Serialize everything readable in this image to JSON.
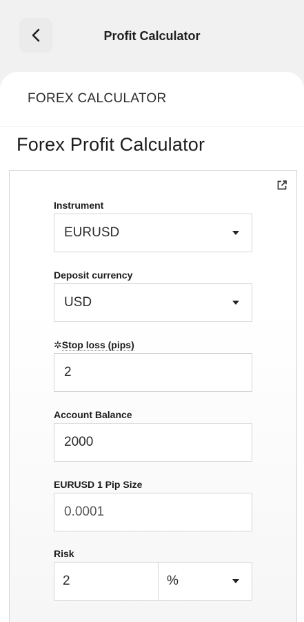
{
  "header": {
    "title": "Profit Calculator",
    "back_icon": "chevron-left-icon"
  },
  "section": {
    "label": "FOREX CALCULATOR"
  },
  "page": {
    "heading": "Forex Profit Calculator",
    "external_icon": "external-link-icon"
  },
  "form": {
    "instrument_label": "Instrument",
    "instrument_value": "EURUSD",
    "deposit_label": "Deposit currency",
    "deposit_value": "USD",
    "stoploss_prefix": "✲",
    "stoploss_label": "Stop loss (pips)",
    "stoploss_value": "2",
    "balance_label": "Account Balance",
    "balance_value": "2000",
    "pipsize_label": "EURUSD 1 Pip Size",
    "pipsize_value": "0.0001",
    "risk_label": "Risk",
    "risk_value": "2",
    "risk_unit": "%"
  }
}
